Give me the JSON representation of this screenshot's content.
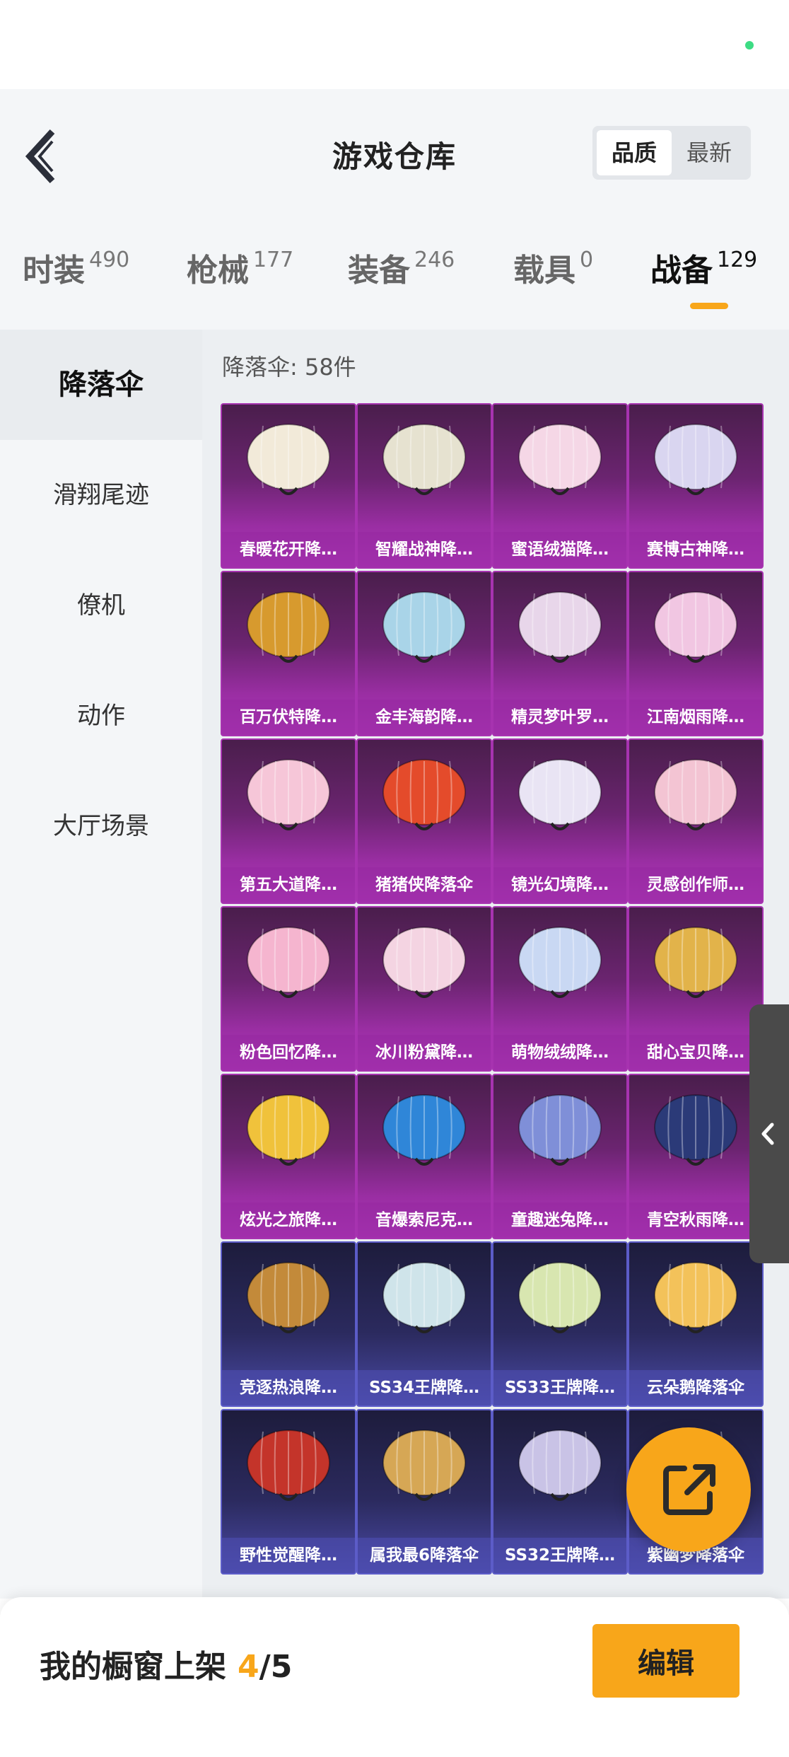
{
  "header": {
    "title": "游戏仓库",
    "sort": [
      "品质",
      "最新"
    ]
  },
  "tabs": [
    {
      "label": "时装",
      "count": "490"
    },
    {
      "label": "枪械",
      "count": "177"
    },
    {
      "label": "装备",
      "count": "246"
    },
    {
      "label": "载具",
      "count": "0"
    },
    {
      "label": "战备",
      "count": "129"
    }
  ],
  "sidebar": {
    "items": [
      "降落伞",
      "滑翔尾迹",
      "僚机",
      "动作",
      "大厅场景"
    ]
  },
  "content": {
    "count_label": "降落伞: 58件"
  },
  "items": [
    {
      "name": "春暖花开降…",
      "rarity": "purple",
      "color": "#f2ead9"
    },
    {
      "name": "智耀战神降…",
      "rarity": "purple",
      "color": "#e6e2d0"
    },
    {
      "name": "蜜语绒猫降…",
      "rarity": "purple",
      "color": "#f5d7e6"
    },
    {
      "name": "赛博古神降…",
      "rarity": "purple",
      "color": "#d9d5f0"
    },
    {
      "name": "百万伏特降…",
      "rarity": "purple",
      "color": "#d79a2e"
    },
    {
      "name": "金丰海韵降…",
      "rarity": "purple",
      "color": "#a9d4e8"
    },
    {
      "name": "精灵梦叶罗…",
      "rarity": "purple",
      "color": "#e8d6ea"
    },
    {
      "name": "江南烟雨降…",
      "rarity": "purple",
      "color": "#f1c6e2"
    },
    {
      "name": "第五大道降…",
      "rarity": "purple",
      "color": "#f6c6d8"
    },
    {
      "name": "猪猪侠降落伞",
      "rarity": "purple",
      "color": "#e44b2b"
    },
    {
      "name": "镜光幻境降…",
      "rarity": "purple",
      "color": "#e9e4f4"
    },
    {
      "name": "灵感创作师…",
      "rarity": "purple",
      "color": "#f3c4d3"
    },
    {
      "name": "粉色回忆降…",
      "rarity": "purple",
      "color": "#f5b5cf"
    },
    {
      "name": "冰川粉黛降…",
      "rarity": "purple",
      "color": "#f4d4e2"
    },
    {
      "name": "萌物绒绒降…",
      "rarity": "purple",
      "color": "#c9d8f3"
    },
    {
      "name": "甜心宝贝降…",
      "rarity": "purple",
      "color": "#e2b34a"
    },
    {
      "name": "炫光之旅降…",
      "rarity": "purple",
      "color": "#f0c23b"
    },
    {
      "name": "音爆索尼克…",
      "rarity": "purple",
      "color": "#2f86d8"
    },
    {
      "name": "童趣迷兔降…",
      "rarity": "purple",
      "color": "#7f8fd8"
    },
    {
      "name": "青空秋雨降…",
      "rarity": "purple",
      "color": "#2b3a78"
    },
    {
      "name": "竞逐热浪降…",
      "rarity": "blue",
      "color": "#c38a3a"
    },
    {
      "name": "SS34王牌降…",
      "rarity": "blue",
      "color": "#cfe4ea"
    },
    {
      "name": "SS33王牌降…",
      "rarity": "blue",
      "color": "#d8e6b0"
    },
    {
      "name": "云朵鹅降落伞",
      "rarity": "blue",
      "color": "#f3c25a"
    },
    {
      "name": "野性觉醒降…",
      "rarity": "blue",
      "color": "#c4342a"
    },
    {
      "name": "属我最6降落伞",
      "rarity": "blue",
      "color": "#d6a755"
    },
    {
      "name": "SS32王牌降…",
      "rarity": "blue",
      "color": "#c9c3e6"
    },
    {
      "name": "紫幽梦降落伞",
      "rarity": "blue",
      "color": "#c4b6e8"
    }
  ],
  "footer": {
    "showcase_label": "我的橱窗上架",
    "showcase_current": "4",
    "showcase_total": "/5",
    "edit_label": "编辑"
  },
  "colors": {
    "accent": "#f8a61a",
    "purple_rarity": "#a733b0",
    "blue_rarity": "#5c5cc8"
  },
  "icons": {
    "back": "chevron-left-icon",
    "share": "external-share-icon",
    "drawer": "chevron-left-icon"
  }
}
